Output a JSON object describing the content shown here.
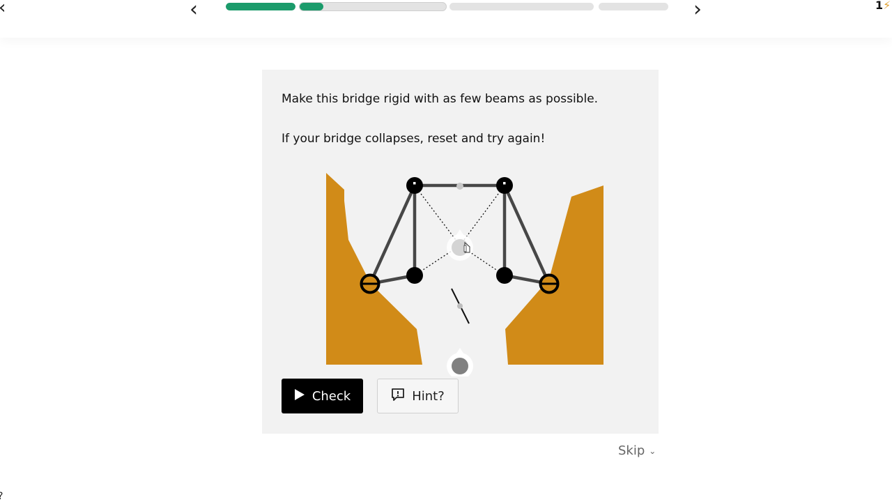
{
  "header": {
    "prev_arrow": "‹",
    "next_arrow": "›",
    "corner_right_text": "1",
    "corner_left_glyph": "‹",
    "progress_segments": [
      {
        "fill": 1.0
      },
      {
        "fill": 0.16
      },
      {
        "fill": 0.0
      },
      {
        "fill": 0.0
      }
    ],
    "progress_color": "#1b9b6b"
  },
  "puzzle": {
    "prompt_line1": "Make this bridge rigid with as few beams as possible.",
    "prompt_line2": "If your bridge collapses, reset and try again!",
    "colors": {
      "cliff": "#d18b18",
      "beam": "#474747",
      "node": "#000000",
      "anchor_fill": "#d18b18",
      "panel_bg": "#f2f2f2"
    }
  },
  "actions": {
    "check_label": "Check",
    "hint_label": "Hint?",
    "skip_label": "Skip",
    "check_icon": "play-icon",
    "hint_icon": "hint-speech-icon"
  }
}
